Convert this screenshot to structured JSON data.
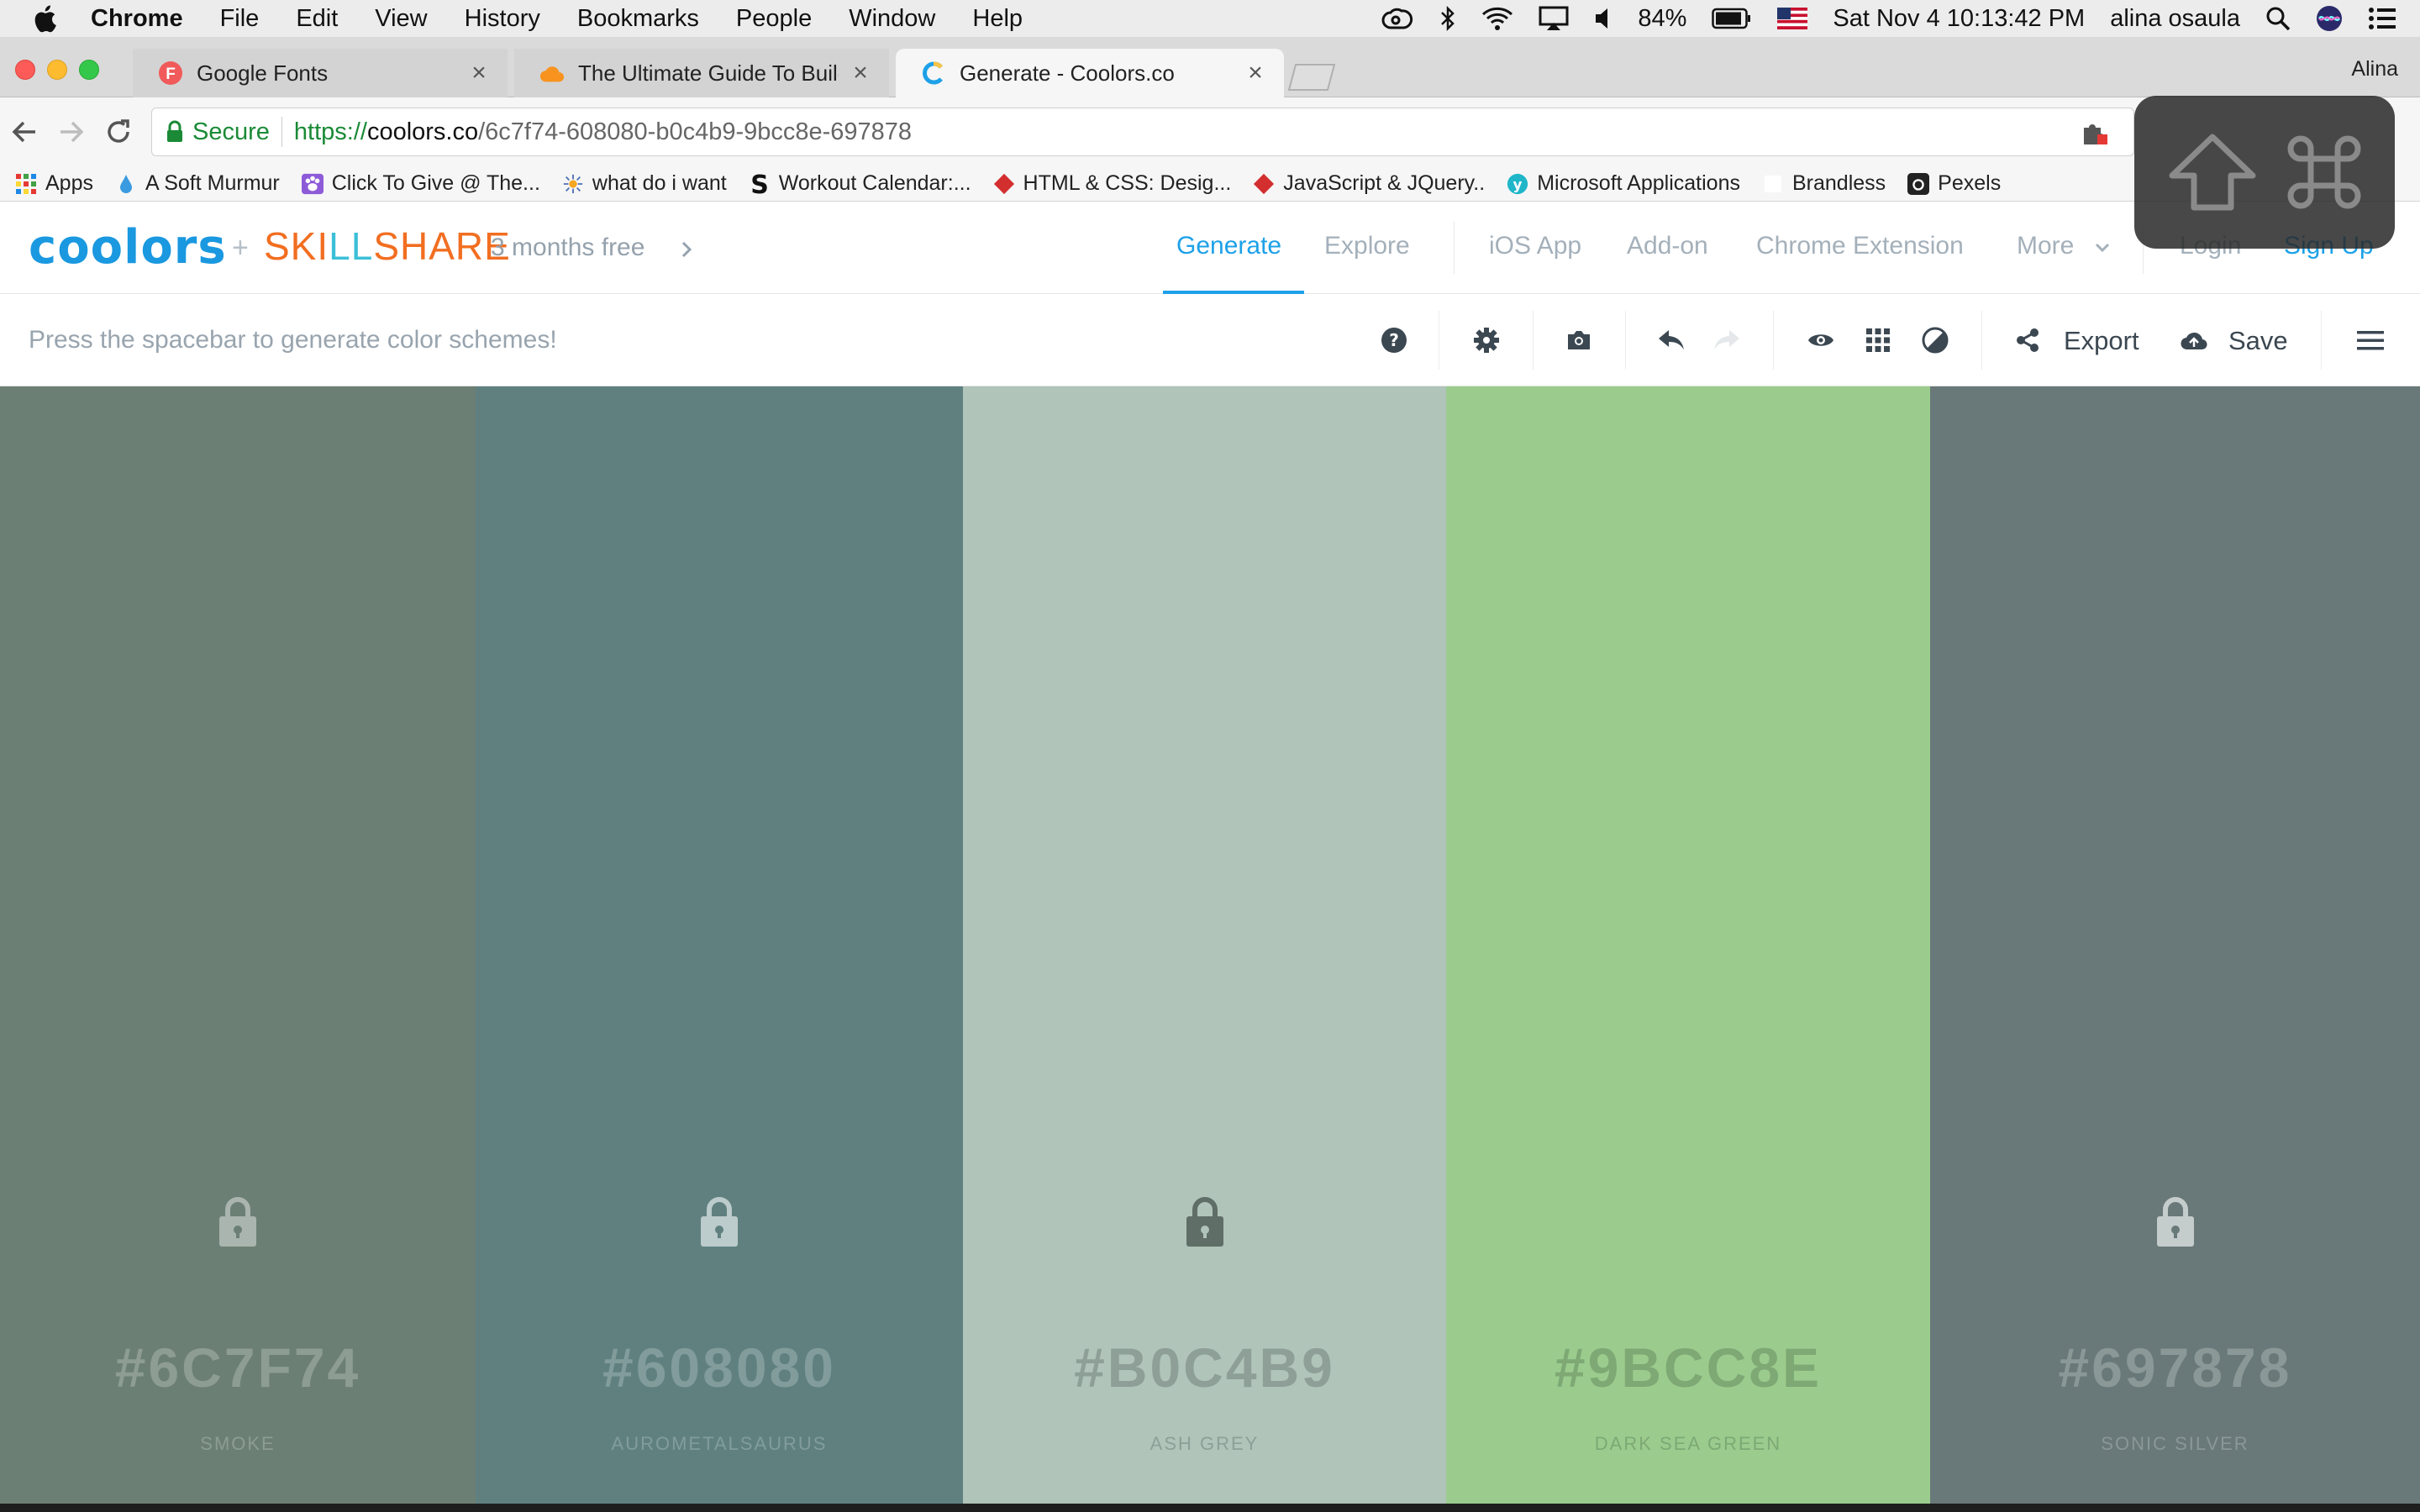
{
  "menubar": {
    "app": "Chrome",
    "items": [
      "File",
      "Edit",
      "View",
      "History",
      "Bookmarks",
      "People",
      "Window",
      "Help"
    ],
    "battery": "84%",
    "datetime": "Sat Nov 4  10:13:42 PM",
    "user": "alina osaula"
  },
  "tabs": [
    {
      "title": "Google Fonts",
      "state": "inactive"
    },
    {
      "title": "The Ultimate Guide To Building",
      "state": "inactive"
    },
    {
      "title": "Generate - Coolors.co",
      "state": "active"
    }
  ],
  "profile_name": "Alina",
  "omnibox": {
    "secure_label": "Secure",
    "url_scheme": "https://",
    "url_host": "coolors.co",
    "url_path": "/6c7f74-608080-b0c4b9-9bcc8e-697878"
  },
  "bookmarks": [
    {
      "label": "Apps",
      "icon": "apps-grid-icon"
    },
    {
      "label": "A Soft Murmur",
      "icon": "drop-icon"
    },
    {
      "label": "Click To Give @ The...",
      "icon": "paw-icon"
    },
    {
      "label": "what do i want",
      "icon": "sun-icon"
    },
    {
      "label": "Workout Calendar:...",
      "icon": "s-logo-icon"
    },
    {
      "label": "HTML & CSS: Desig...",
      "icon": "diamond-icon"
    },
    {
      "label": "JavaScript & JQuery..",
      "icon": "diamond-icon"
    },
    {
      "label": "Microsoft Applications",
      "icon": "y-logo-icon"
    },
    {
      "label": "Brandless",
      "icon": "blank-icon"
    },
    {
      "label": "Pexels",
      "icon": "camera-icon"
    }
  ],
  "site": {
    "logo": "coolors",
    "plus": "+",
    "partner_logo": "SKILLSHARE",
    "promo": "3 months free",
    "nav": [
      "Generate",
      "Explore",
      "iOS App",
      "Add-on",
      "Chrome Extension",
      "More"
    ],
    "login": "Login",
    "signup": "Sign Up"
  },
  "generator": {
    "hint": "Press the spacebar to generate color schemes!",
    "export_label": "Export",
    "save_label": "Save"
  },
  "palette": [
    {
      "hex": "#6C7F74",
      "name": "SMOKE",
      "bg": "#6c7f74",
      "text": "#8d9d94",
      "lock": "#a9b5ae"
    },
    {
      "hex": "#608080",
      "name": "AUROMETALSAURUS",
      "bg": "#608080",
      "text": "#829c9c",
      "lock": "#bccbcb"
    },
    {
      "hex": "#B0C4B9",
      "name": "ASH GREY",
      "bg": "#b0c4b9",
      "text": "#8d9f96",
      "lock": "#5f6e66"
    },
    {
      "hex": "#9BCC8E",
      "name": "DARK SEA GREEN",
      "bg": "#9bcc8e",
      "text": "#7ea874",
      "lock": "#9bcc8e"
    },
    {
      "hex": "#697878",
      "name": "SONIC SILVER",
      "bg": "#697878",
      "text": "#8a9898",
      "lock": "#c4cccc"
    }
  ],
  "colors": {
    "accent": "#1da1e8",
    "nav_muted": "#a4b0ba",
    "skillshare": [
      "#f26e21",
      "#3cc0d8"
    ]
  }
}
